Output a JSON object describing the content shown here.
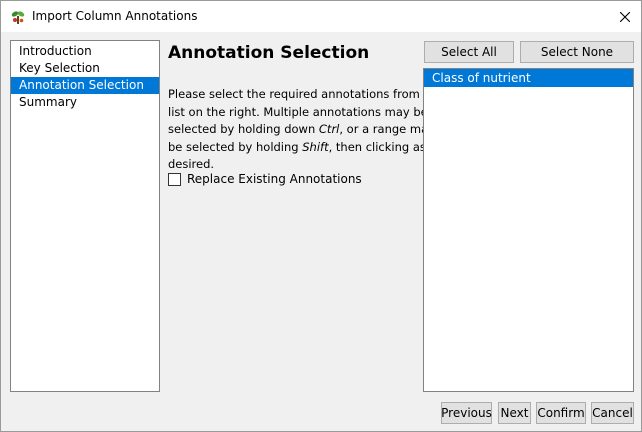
{
  "window": {
    "title": "Import Column Annotations",
    "icon": "app-plant-icon",
    "close_icon": "close-icon"
  },
  "steps": [
    {
      "label": "Introduction",
      "selected": false
    },
    {
      "label": "Key Selection",
      "selected": false
    },
    {
      "label": "Annotation Selection",
      "selected": true
    },
    {
      "label": "Summary",
      "selected": false
    }
  ],
  "content": {
    "title": "Annotation Selection",
    "desc": {
      "line1": "Please select the required annotations from the",
      "line2": "list on the right. Multiple annotations may be",
      "line3_a": "selected by holding down ",
      "line3_ctrl": "Ctrl",
      "line3_b": ", or a range may",
      "line4_a": "be selected by holding ",
      "line4_shift": "Shift",
      "line4_b": ", then clicking as",
      "line5": "desired."
    },
    "replace_label": "Replace Existing Annotations",
    "replace_checked": false
  },
  "selection_buttons": {
    "select_all": "Select All",
    "select_none": "Select None"
  },
  "annotations": [
    {
      "label": "Class of nutrient",
      "selected": true
    }
  ],
  "footer": {
    "previous": "Previous",
    "next": "Next",
    "confirm": "Confirm",
    "cancel": "Cancel"
  },
  "colors": {
    "selection": "#0078d7",
    "background": "#f0f0f0"
  }
}
